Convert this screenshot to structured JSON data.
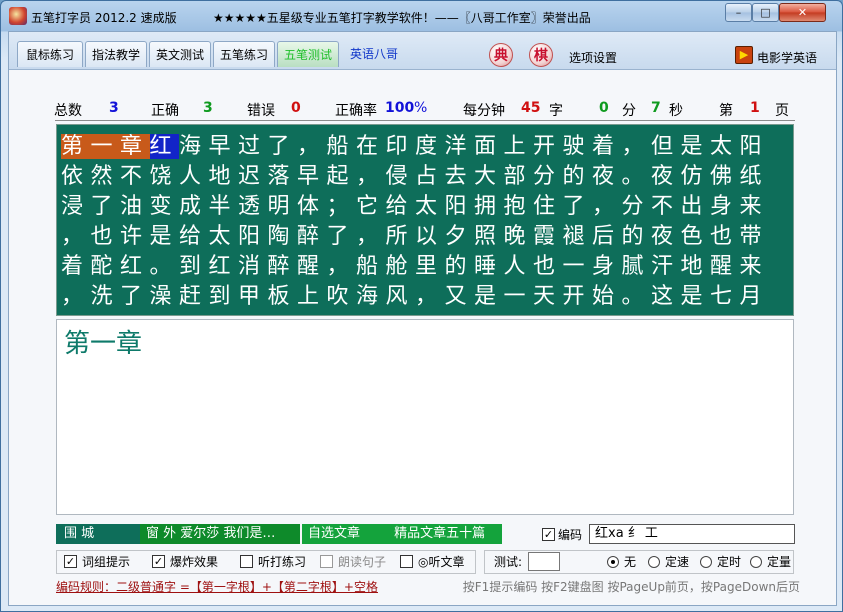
{
  "window": {
    "title": "五笔打字员 2012.2 速成版",
    "slogan": "★★★★★五星级专业五笔打字教学软件！——〖八哥工作室〗荣誉出品",
    "min_glyph": "–",
    "max_glyph": "□",
    "close_glyph": "✕"
  },
  "tabs": [
    {
      "label": "鼠标练习"
    },
    {
      "label": "指法教学"
    },
    {
      "label": "英文测试"
    },
    {
      "label": "五笔练习"
    },
    {
      "label": "五笔测试"
    },
    {
      "label": "英语八哥"
    }
  ],
  "toolbar": {
    "dict_icon": "典",
    "chess_icon": "棋",
    "options_label": "选项设置",
    "movie_label": "电影学英语",
    "movie_icon": "film-icon"
  },
  "stats": {
    "total_label": "总数",
    "total_value": "3",
    "correct_label": "正确",
    "correct_value": "3",
    "error_label": "错误",
    "error_value": "0",
    "rate_label": "正确率",
    "rate_value": "100",
    "rate_unit": "%",
    "speed_label": "每分钟",
    "speed_value": "45",
    "speed_unit": "字",
    "min_value": "0",
    "min_unit": "分",
    "sec_value": "7",
    "sec_unit": "秒",
    "page_prefix": "第",
    "page_value": "1",
    "page_suffix": "页"
  },
  "text": {
    "line1_done": "第一章",
    "line1_current": "红",
    "line1_rest": "海早过了，船在印度洋面上开驶着，但是太阳",
    "line2": "依然不饶人地迟落早起，侵占去大部分的夜。夜仿佛纸",
    "line3": "浸了油变成半透明体；它给太阳拥抱住了，分不出身来",
    "line4": "，也许是给太阳陶醉了，所以夕照晚霞褪后的夜色也带",
    "line5": "着酡红。到红消醉醒，船舱里的睡人也一身腻汗地醒来",
    "line6": "，洗了澡赶到甲板上吹海风，又是一天开始。这是七月"
  },
  "input": {
    "typed": "第一章"
  },
  "bottom": {
    "book_name": "围 城",
    "book_title": "窗 外  爱尔莎  我们是…",
    "select_article": "自选文章",
    "featured": "精品文章五十篇",
    "code_label": "编码",
    "code_value": "红xa           纟 工",
    "check_mark": "✓",
    "options": [
      {
        "label": "词组提示",
        "checked": true
      },
      {
        "label": "爆炸效果",
        "checked": true
      },
      {
        "label": "听打练习",
        "checked": false
      },
      {
        "label": "朗读句子",
        "checked": false,
        "disabled": true
      },
      {
        "label": "◎听文章",
        "checked": false
      }
    ],
    "test_label": "测试:",
    "modes": [
      {
        "label": "无",
        "selected": true
      },
      {
        "label": "定速",
        "selected": false
      },
      {
        "label": "定时",
        "selected": false
      },
      {
        "label": "定量",
        "selected": false
      }
    ],
    "rule": "编码规则：二级普通字 =【第一字根】+【第二字根】+空格",
    "hint": "按F1提示编码  按F2键盘图  按PageUp前页，按PageDown后页"
  }
}
